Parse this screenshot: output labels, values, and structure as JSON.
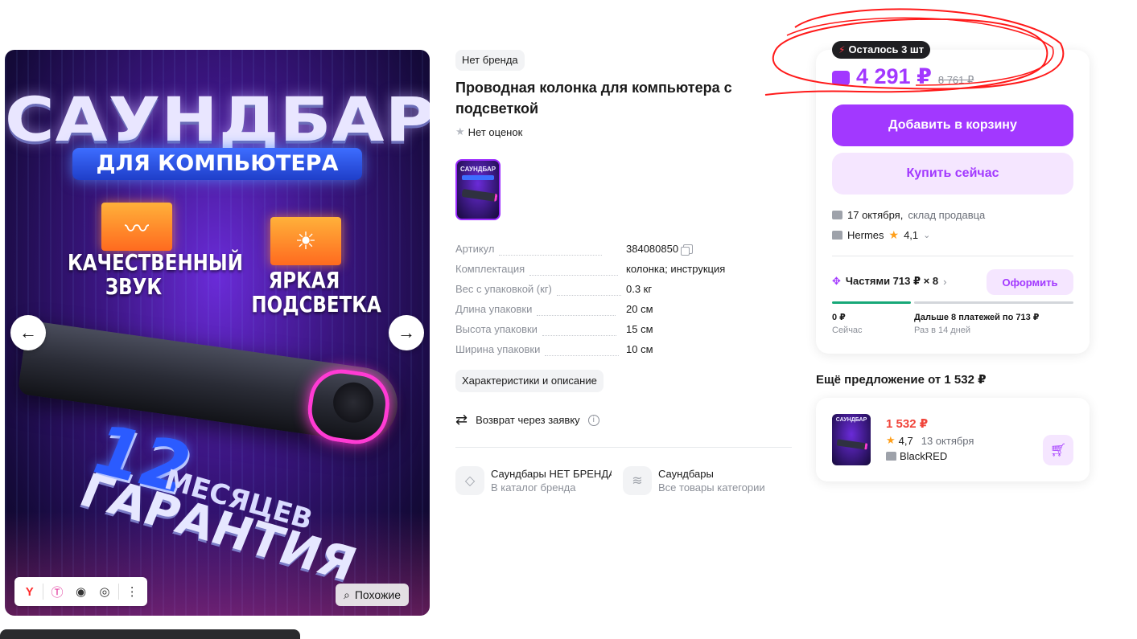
{
  "gallery": {
    "headline": "САУНДБАР",
    "ribbon": "ДЛЯ КОМПЬЮТЕРА",
    "feature_1": "КАЧЕСТВЕННЫЙ ЗВУК",
    "feature_2": "ЯРКАЯ ПОДСВЕТКА",
    "warranty_number": "12",
    "warranty_months": "МЕСЯЦЕВ",
    "warranty_word": "ГАРАНТИЯ",
    "prev_icon": "arrow-left-icon",
    "next_icon": "arrow-right-icon",
    "similar_label": "Похожие",
    "toolbar_icons": [
      "yandex-icon",
      "translate-icon",
      "eye-icon",
      "camera-search-icon",
      "more-icon"
    ]
  },
  "product": {
    "brand": "Нет бренда",
    "title": "Проводная колонка для компьютера с подсветкой",
    "rating_text": "Нет оценок",
    "thumb_label": "САУНДБАР"
  },
  "specs": [
    {
      "name": "Артикул",
      "value": "384080850"
    },
    {
      "name": "Комплектация",
      "value": "колонка; инструкция"
    },
    {
      "name": "Вес с упаковкой (кг)",
      "value": "0.3 кг"
    },
    {
      "name": "Длина упаковки",
      "value": "20 см"
    },
    {
      "name": "Высота упаковки",
      "value": "15 см"
    },
    {
      "name": "Ширина упаковки",
      "value": "10 см"
    }
  ],
  "details_chip": "Характеристики и описание",
  "return_text": "Возврат через заявку",
  "links": [
    {
      "title": "Саундбары НЕТ БРЕНДА",
      "sub": "В каталог бренда",
      "icon": "tag-icon"
    },
    {
      "title": "Саундбары",
      "sub": "Все товары категории",
      "icon": "layers-icon"
    }
  ],
  "buy": {
    "stock_text": "Осталось 3 шт",
    "price": "4 291 ₽",
    "old_price": "8 761 ₽",
    "add_to_cart": "Добавить в корзину",
    "buy_now": "Купить сейчас",
    "delivery_date": "17 октября,",
    "delivery_note": "склад продавца",
    "seller": "Hermes",
    "seller_rating": "4,1",
    "parts_label": "Частями 713 ₽ × 8",
    "parts_button": "Оформить",
    "pay_now_amount": "0 ₽",
    "pay_now_label": "Сейчас",
    "pay_later_amount": "Дальше 8 платежей по 713 ₽",
    "pay_later_label": "Раз в 14 дней",
    "accent_color": "#a238ff"
  },
  "other_offer": {
    "heading": "Ещё предложение от 1 532 ₽",
    "price": "1 532 ₽",
    "rating": "4,7",
    "date": "13 октября",
    "seller": "BlackRED",
    "img_label": "САУНДБАР"
  }
}
